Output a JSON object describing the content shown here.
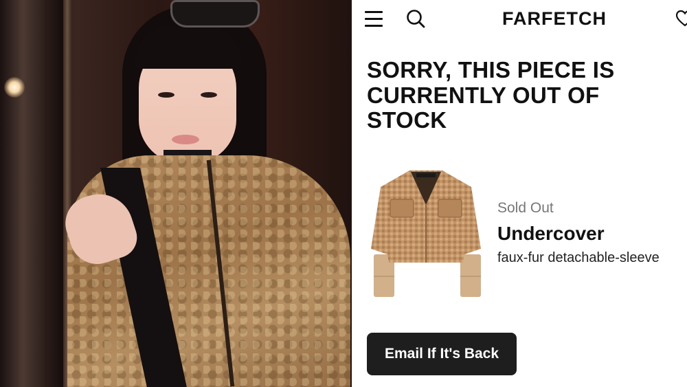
{
  "header": {
    "brand": "FARFETCH",
    "menu_icon": "hamburger-menu-icon",
    "search_icon": "search-icon",
    "wishlist_icon": "heart-icon"
  },
  "message": {
    "headline": "SORRY, THIS PIECE IS CURRENTLY OUT OF STOCK"
  },
  "product": {
    "status": "Sold Out",
    "designer": "Undercover",
    "description": "faux-fur detachable-sleeve"
  },
  "actions": {
    "notify_label": "Email If It's Back"
  },
  "colors": {
    "text": "#111111",
    "muted": "#777777",
    "button_bg": "#1e1e1e",
    "jacket": "#b58a5c"
  }
}
